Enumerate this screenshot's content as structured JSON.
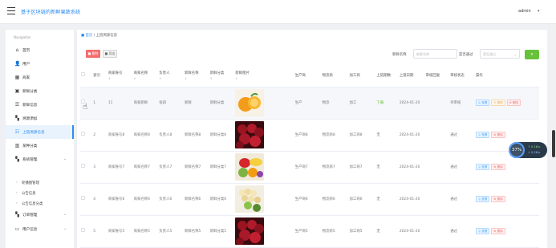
{
  "header": {
    "title": "基于区块链的新鲜果蔬系统",
    "user": "admin",
    "user_caret": "▾"
  },
  "sidebar": {
    "heading": "Navigation",
    "items": [
      {
        "label": "首页",
        "icon": "home-icon",
        "glyph": "⌂"
      },
      {
        "label": "用户",
        "icon": "user-icon",
        "glyph": "👤"
      },
      {
        "label": "商家",
        "icon": "shop-icon",
        "glyph": "▦"
      },
      {
        "label": "新鲜分类",
        "icon": "category-icon",
        "glyph": "▣"
      },
      {
        "label": "新鲜信息",
        "icon": "sliders-icon",
        "glyph": "☰"
      },
      {
        "label": "溯源添加",
        "icon": "grid-icon",
        "glyph": "▚"
      },
      {
        "label": "上链溯源信息",
        "icon": "list-icon",
        "glyph": "☷"
      },
      {
        "label": "某种分类",
        "icon": "chart-icon",
        "glyph": "▥"
      },
      {
        "label": "系统管理",
        "icon": "apps-icon",
        "glyph": "▚"
      },
      {
        "label": "订单管理",
        "icon": "apps-icon",
        "glyph": "▚"
      },
      {
        "label": "用户信息",
        "icon": "card-icon",
        "glyph": "▭"
      }
    ],
    "sub_items": [
      "轮播图管理",
      "公告信息",
      "公告信息分类"
    ]
  },
  "breadcrumb": {
    "home": "■ 首页",
    "sep": "/",
    "current": "上链溯源信息"
  },
  "toolbar": {
    "delete": "■ 删除",
    "export": "■ 导出"
  },
  "filters": {
    "name_label": "新鲜名称",
    "name_placeholder": "新鲜名称",
    "status_label": "是否通过",
    "status_placeholder": "是否通过",
    "search": "⌕"
  },
  "table": {
    "columns": [
      "索引",
      "商家账号",
      "商家名称",
      "负责人",
      "新鲜名称",
      "新鲜分类",
      "新鲜图片",
      "生产商",
      "物流商",
      "加工商",
      "上链期数",
      "上链日期",
      "审核回复",
      "审核状态",
      "操作"
    ],
    "sort_mark": "⇕",
    "rows": [
      {
        "idx": "1",
        "acct": "11",
        "shop": "商家新鲜",
        "owner": "张四",
        "name": "新鲜",
        "cat": "新鲜分类",
        "img": "orange",
        "maker": "生产",
        "logi": "物流",
        "proc": "加工",
        "period": "下载",
        "date": "2024-01-20",
        "reply": "",
        "status": "待审核",
        "actions": [
          "查看",
          "修改",
          "删除"
        ]
      },
      {
        "idx": "2",
        "acct": "商家账号8",
        "shop": "商家名称8",
        "owner": "负责人8",
        "name": "新鲜名称8",
        "cat": "新鲜分类8",
        "img": "cherry",
        "maker": "生产商8",
        "logi": "物流商8",
        "proc": "加工商8",
        "period": "无",
        "date": "2024-01-20",
        "reply": "",
        "status": "通过",
        "actions": [
          "查看",
          "删除"
        ]
      },
      {
        "idx": "3",
        "acct": "商家账号7",
        "shop": "商家名称7",
        "owner": "负责人7",
        "name": "新鲜名称7",
        "cat": "新鲜分类7",
        "img": "mixed",
        "maker": "生产商7",
        "logi": "物流商7",
        "proc": "加工商7",
        "period": "无",
        "date": "2024-01-20",
        "reply": "",
        "status": "通过",
        "actions": [
          "查看",
          "删除"
        ]
      },
      {
        "idx": "4",
        "acct": "商家账号6",
        "shop": "商家名称6",
        "owner": "负责人6",
        "name": "新鲜名称6",
        "cat": "新鲜分类6",
        "img": "grapes",
        "maker": "生产商6",
        "logi": "物流商6",
        "proc": "加工商6",
        "period": "无",
        "date": "2024-01-20",
        "reply": "",
        "status": "通过",
        "actions": [
          "查看",
          "删除"
        ]
      },
      {
        "idx": "5",
        "acct": "商家账号5",
        "shop": "商家名称5",
        "owner": "负责人5",
        "name": "新鲜名称5",
        "cat": "新鲜分类5",
        "img": "cherry",
        "maker": "生产商5",
        "logi": "物流商5",
        "proc": "加工商5",
        "period": "无",
        "date": "2024-01-20",
        "reply": "",
        "status": "通过",
        "actions": [
          "查看",
          "删除"
        ]
      }
    ]
  },
  "widget": {
    "percent": "37%",
    "up": "↑ 0.1K/s",
    "down": "↓ 0.2K/s"
  },
  "colors": {
    "accent": "#2d8cf0",
    "danger": "#f56c6c",
    "success": "#67c23a"
  }
}
